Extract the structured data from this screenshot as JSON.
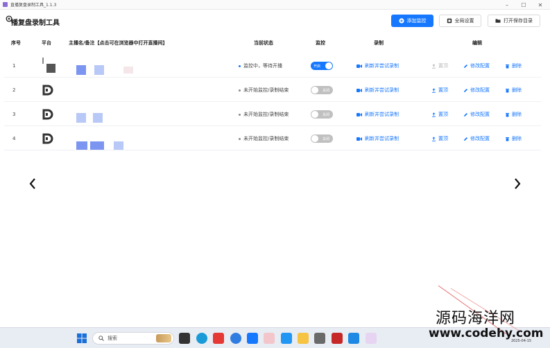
{
  "window": {
    "title": "直播复盘录制工具_1.1.3"
  },
  "app": {
    "title": "播复盘录制工具"
  },
  "toolbar": {
    "add_label": "添加监控",
    "settings_label": "全局设置",
    "open_dir_label": "打开保存目录"
  },
  "table": {
    "headers": {
      "index": "序号",
      "platform": "平台",
      "streamer": "主播名/备注【点击可在浏览器中打开直播间】",
      "status": "当前状态",
      "monitor": "监控",
      "record": "录制",
      "edit": "编辑"
    },
    "rows": [
      {
        "index": "1",
        "status": "监控中，等待开播",
        "monitor": "开启",
        "record": "刷新并尝试录制",
        "top": "置顶",
        "edit": "修改配置",
        "delete": "删除"
      },
      {
        "index": "2",
        "status": "未开始监控/录制结束",
        "monitor": "关闭",
        "record": "刷新并尝试录制",
        "top": "置顶",
        "edit": "修改配置",
        "delete": "删除"
      },
      {
        "index": "3",
        "status": "未开始监控/录制结束",
        "monitor": "关闭",
        "record": "刷新并尝试录制",
        "top": "置顶",
        "edit": "修改配置",
        "delete": "删除"
      },
      {
        "index": "4",
        "status": "未开始监控/录制结束",
        "monitor": "关闭",
        "record": "刷新并尝试录制",
        "top": "置顶",
        "edit": "修改配置",
        "delete": "删除"
      }
    ]
  },
  "taskbar": {
    "search_placeholder": "搜索",
    "date": "2025-04-15"
  },
  "watermark": {
    "cn": "源码海洋网",
    "url": "www.codehy.com"
  },
  "colors": {
    "primary": "#1677ff",
    "switch_off": "#c0c0c0",
    "disabled": "#b8b8b8"
  }
}
